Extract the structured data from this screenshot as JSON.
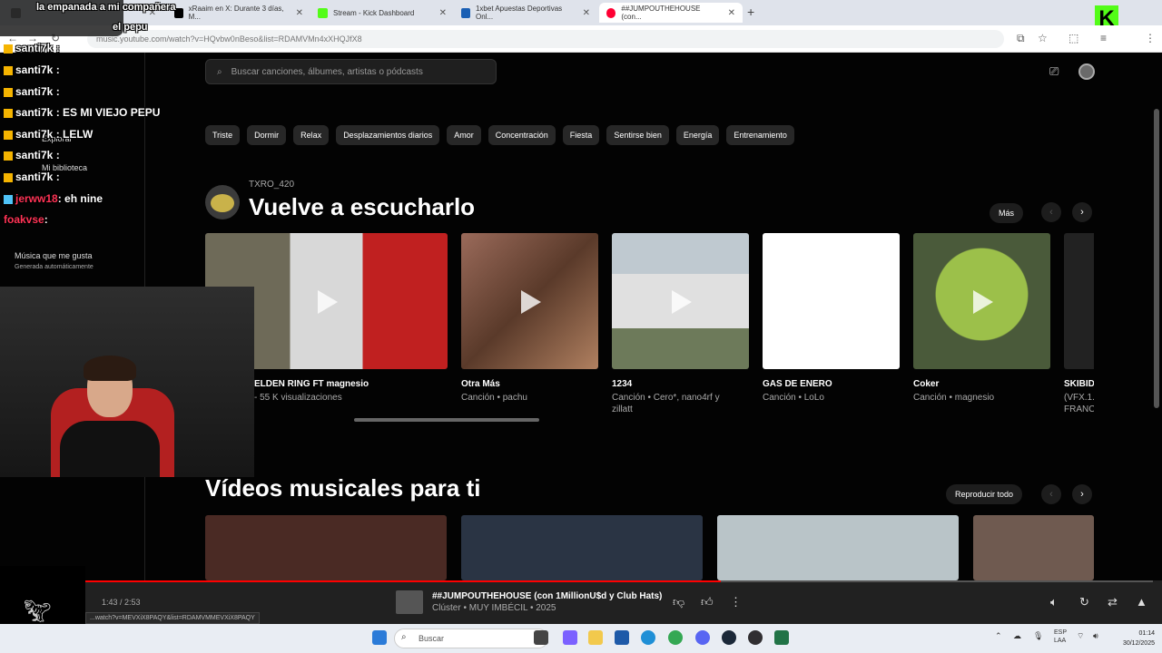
{
  "browser": {
    "tabs": [
      {
        "label": "",
        "color": "#666"
      },
      {
        "label": "xRaaim en X: Durante 3 días, M...",
        "color": "#000"
      },
      {
        "label": "Stream - Kick Dashboard",
        "color": "#53fc18"
      },
      {
        "label": "1xbet Apuestas Deportivas Onl...",
        "color": "#1a5fb4"
      },
      {
        "label": "##JUMPOUTHEHOUSE (con...",
        "color": "#ff0033"
      }
    ],
    "url": "music.youtube.com/watch?v=HQvbw0nBeso&list=RDAMVMn4xXHQJfX8"
  },
  "search": {
    "placeholder": "Buscar canciones, álbumes, artistas o pódcasts"
  },
  "sidebar": {
    "explore": "Explorar",
    "library": "Mi biblioteca",
    "liked": "Música que me gusta",
    "liked_sub": "Generada automáticamente"
  },
  "chips": [
    "Triste",
    "Dormir",
    "Relax",
    "Desplazamientos diarios",
    "Amor",
    "Concentración",
    "Fiesta",
    "Sentirse bien",
    "Energía",
    "Entrenamiento"
  ],
  "listen_again": {
    "user": "TXRO_420",
    "title": "Vuelve a escucharlo",
    "more_label": "Más",
    "cards": [
      {
        "title": "ELDEN RING FT magnesio",
        "sub": "- 55 K visualizaciones",
        "sub2": "",
        "color": "#7a6a4a"
      },
      {
        "title": "Otra Más",
        "sub": "Canción • pachu",
        "sub2": "",
        "color": "#8a5a4a"
      },
      {
        "title": "1234",
        "sub": "Canción • Cero*, nano4rf y",
        "sub2": "zillatt",
        "color": "#7d8a70"
      },
      {
        "title": "GAS DE ENERO",
        "sub": "Canción • LoLo",
        "sub2": "",
        "color": "#ffffff"
      },
      {
        "title": "Coker",
        "sub": "Canción • magnesio",
        "sub2": "",
        "color": "#7fa040"
      },
      {
        "title": "SKIBID",
        "sub": "(VFX.1...",
        "sub2": "FRANC",
        "color": "#333"
      }
    ]
  },
  "music_videos": {
    "title": "Vídeos musicales para ti",
    "play_all_label": "Reproducir todo",
    "thumbs": [
      {
        "color": "#4a2a24"
      },
      {
        "color": "#2a3444"
      },
      {
        "color": "#b9c4c8"
      },
      {
        "color": "#6f5a50"
      }
    ]
  },
  "player": {
    "time": "1:43 / 2:53",
    "progress": 0.595,
    "title": "##JUMPOUTHEHOUSE (con 1MillionU$d y Club Hats)",
    "sub": "Clúster • MUY IMBÉCIL • 2025",
    "status_url": "...watch?v=MEVXiX8PAQY&list=RDAMVMMEVXiX8PAQY"
  },
  "stream_overlay": {
    "chat": [
      {
        "user": "santi7k",
        "msg": ":",
        "color": "#ffffff"
      },
      {
        "user": "santi7k",
        "msg": ":",
        "color": "#ffffff"
      },
      {
        "user": "santi7k",
        "msg": ":",
        "color": "#ffffff"
      },
      {
        "user": "santi7k",
        "msg": ": ES MI VIEJO PEPU",
        "color": "#ffffff"
      },
      {
        "user": "santi7k",
        "msg": ": LELW",
        "color": "#ffffff"
      },
      {
        "user": "santi7k",
        "msg": ":",
        "color": "#ffffff"
      },
      {
        "user": "santi7k",
        "msg": ":",
        "color": "#ffffff"
      },
      {
        "user": "jerww18",
        "msg": ": eh nine",
        "color": "#ff3355"
      },
      {
        "user": "foakvse",
        "msg": ":",
        "color": "#ff3355"
      }
    ],
    "top_text": "la empanada a mi compañera",
    "top_text2": "el pepu"
  },
  "taskbar": {
    "search": "Buscar",
    "lang": "ESP",
    "lang2": "LAA",
    "time": "01:14",
    "date": "30/12/2025"
  }
}
